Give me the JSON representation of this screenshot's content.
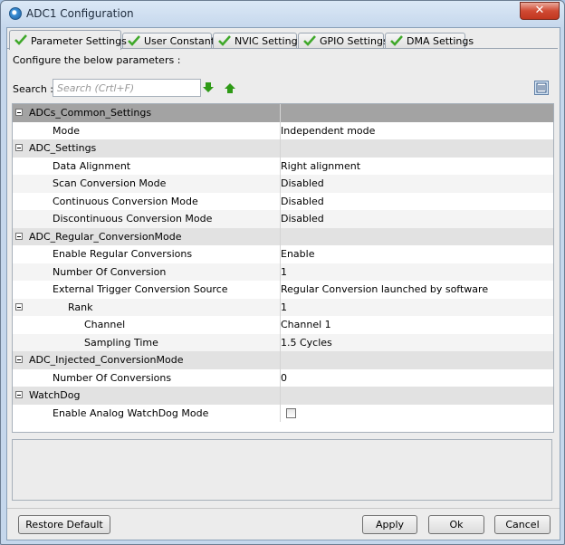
{
  "window": {
    "title": "ADC1 Configuration",
    "close_label": "✕"
  },
  "tabs": [
    {
      "label": "Parameter Settings",
      "active": true
    },
    {
      "label": "User Constants"
    },
    {
      "label": "NVIC Settings"
    },
    {
      "label": "GPIO Settings"
    },
    {
      "label": "DMA Settings"
    }
  ],
  "hint": "Configure the below parameters :",
  "search": {
    "label": "Search :",
    "placeholder": "Search (Crtl+F)"
  },
  "rows": [
    {
      "name": "ADCs_Common_Settings",
      "value": ""
    },
    {
      "name": "Mode",
      "value": "Independent mode"
    },
    {
      "name": "ADC_Settings",
      "value": ""
    },
    {
      "name": "Data Alignment",
      "value": "Right alignment"
    },
    {
      "name": "Scan Conversion Mode",
      "value": "Disabled"
    },
    {
      "name": "Continuous Conversion Mode",
      "value": "Disabled"
    },
    {
      "name": "Discontinuous Conversion Mode",
      "value": "Disabled"
    },
    {
      "name": "ADC_Regular_ConversionMode",
      "value": ""
    },
    {
      "name": "Enable Regular Conversions",
      "value": "Enable"
    },
    {
      "name": "Number Of Conversion",
      "value": "1"
    },
    {
      "name": "External Trigger Conversion Source",
      "value": "Regular Conversion launched by software"
    },
    {
      "name": "Rank",
      "value": "1"
    },
    {
      "name": "Channel",
      "value": "Channel 1"
    },
    {
      "name": "Sampling Time",
      "value": "1.5 Cycles"
    },
    {
      "name": "ADC_Injected_ConversionMode",
      "value": ""
    },
    {
      "name": "Number Of Conversions",
      "value": "0"
    },
    {
      "name": "WatchDog",
      "value": ""
    },
    {
      "name": "Enable Analog WatchDog Mode",
      "value": "",
      "checked": false
    }
  ],
  "buttons": {
    "restore": "Restore Default",
    "apply": "Apply",
    "ok": "Ok",
    "cancel": "Cancel"
  },
  "colors": {
    "check_green": "#3fa82a",
    "arrow_green": "#2e9a16",
    "selected_row": "#a3a3a3"
  }
}
